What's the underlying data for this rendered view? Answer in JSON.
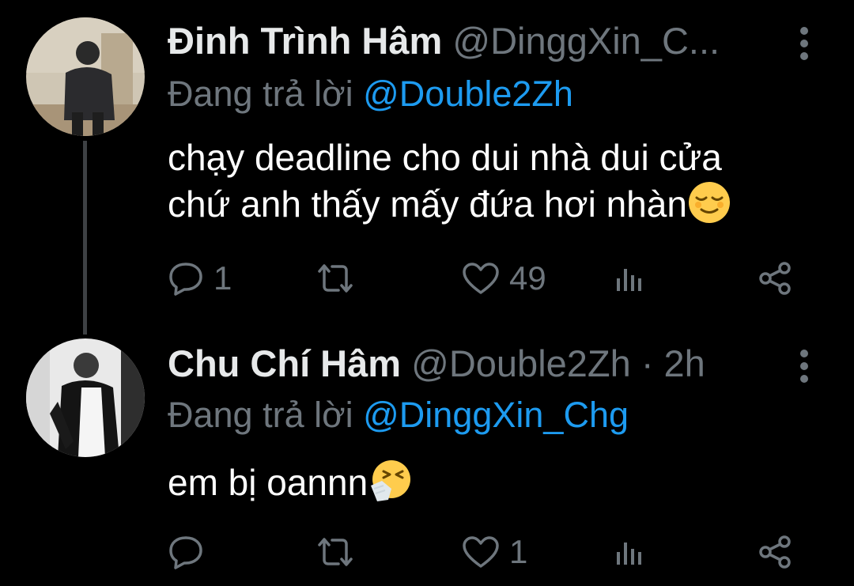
{
  "tweets": [
    {
      "name": "Đinh Trình Hâm",
      "handle": "@DinggXin_C...",
      "time_sep": "",
      "time": "",
      "replying_prefix": "Đang trả lời",
      "replying_to": "@Double2Zh",
      "text_line1": "chạy deadline cho dui nhà dui cửa",
      "text_line2": "chứ anh thấy mấy đứa hơi nhàn",
      "emoji": "relieved-face",
      "reply_count": "1",
      "retweet_count": "",
      "like_count": "49"
    },
    {
      "name": "Chu Chí Hâm",
      "handle": "@Double2Zh",
      "time_sep": "·",
      "time": "2h",
      "replying_prefix": "Đang trả lời",
      "replying_to": "@DinggXin_Chg",
      "text_line1": "em bị oannn",
      "emoji": "sneezing-face",
      "reply_count": "",
      "retweet_count": "",
      "like_count": "1"
    }
  ],
  "colors": {
    "background": "#000000",
    "text": "#ffffff",
    "muted": "#6e767d",
    "mention": "#1d9bf0",
    "thread_line": "#3e4144"
  }
}
